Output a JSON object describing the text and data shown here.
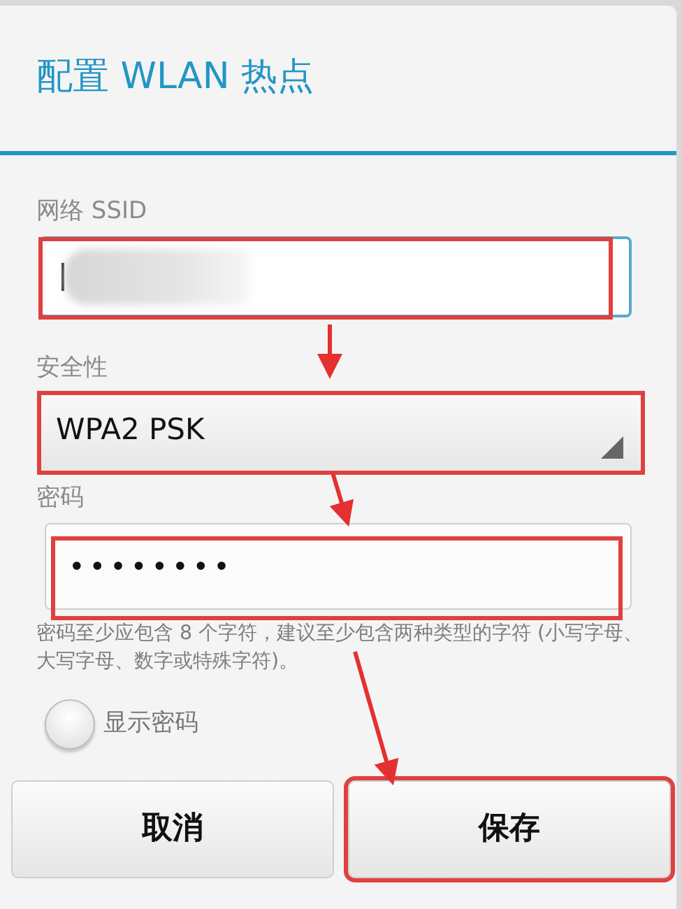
{
  "dialog": {
    "title": "配置 WLAN 热点"
  },
  "ssid": {
    "label": "网络 SSID"
  },
  "security": {
    "label": "安全性",
    "value": "WPA2 PSK"
  },
  "password": {
    "label": "密码",
    "value": "••••••••",
    "hint": "密码至少应包含 8 个字符，建议至少包含两种类型的字符 (小写字母、大写字母、数字或特殊字符)。"
  },
  "show_password": {
    "label": "显示密码",
    "checked": false
  },
  "buttons": [
    {
      "label": "取消",
      "annotated": false
    },
    {
      "label": "保存",
      "annotated": true
    }
  ]
}
